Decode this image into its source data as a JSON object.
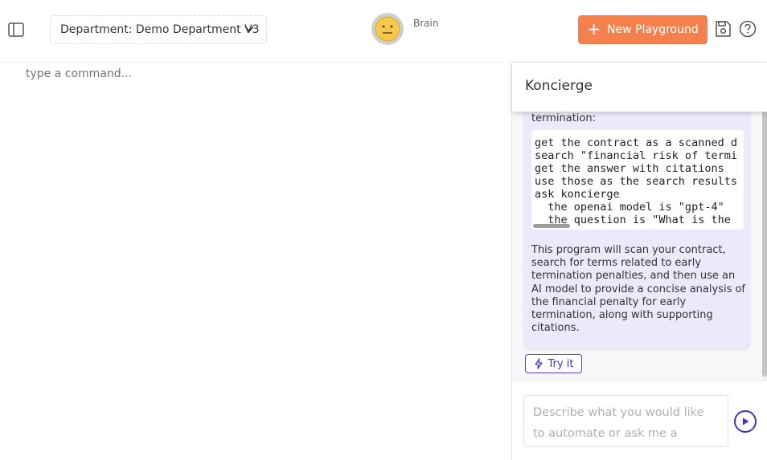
{
  "header": {
    "department_select": "Department: Demo Department V3",
    "brain_label": "Brain",
    "new_playground_label": "New Playground"
  },
  "workspace": {
    "command_placeholder": "type a command..."
  },
  "panel": {
    "title": "Koncierge",
    "message_intro": "termination:",
    "code_lines": [
      "get the contract as a scanned d",
      "search \"financial risk of termi",
      "get the answer with citations",
      "use those as the search results",
      "ask koncierge",
      "  the openai model is \"gpt-4\"",
      "  the question is \"What is the"
    ],
    "description": "This program will scan your contract, search for terms related to early termination penalties, and then use an AI model to provide a concise analysis of the financial penalty for early termination, along with supporting citations.",
    "try_it_label": "Try it",
    "chat_placeholder": "Describe what you would like to automate or ask me a question"
  },
  "colors": {
    "accent_orange": "#f4814d",
    "accent_purple": "#4a30b8",
    "bubble_bg": "#ece9fb"
  },
  "icons": {
    "sidebar_toggle": "sidebar-toggle-icon",
    "chevron": "chevron-down-icon",
    "plus": "plus-icon",
    "save": "save-icon",
    "help": "help-icon",
    "bolt": "lightning-icon",
    "send": "play-icon"
  }
}
